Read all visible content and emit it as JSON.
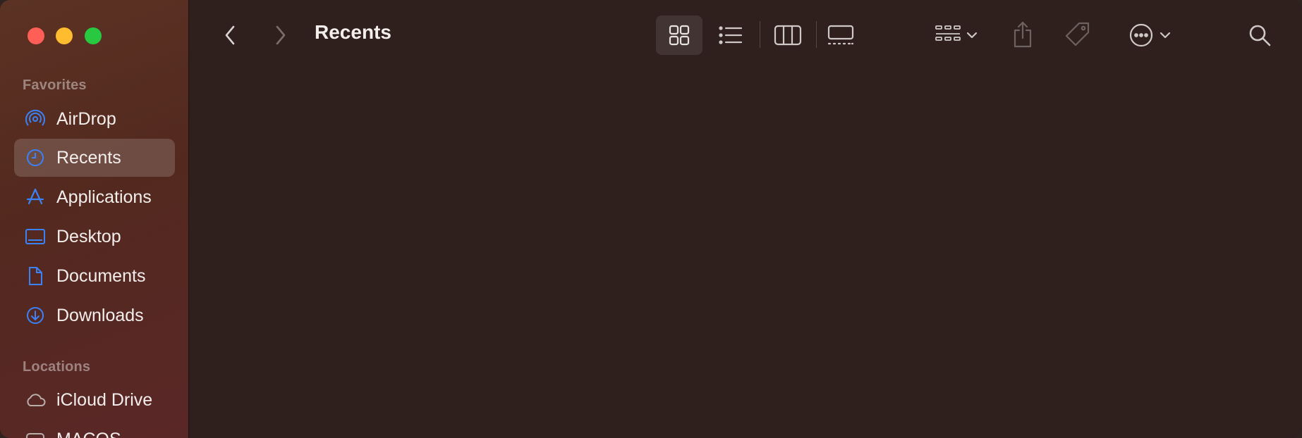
{
  "window": {
    "title": "Recents"
  },
  "sidebar": {
    "favorites_header": "Favorites",
    "locations_header": "Locations",
    "favorites": [
      {
        "label": "AirDrop",
        "icon": "airdrop-icon"
      },
      {
        "label": "Recents",
        "icon": "clock-icon",
        "selected": true
      },
      {
        "label": "Applications",
        "icon": "applications-icon"
      },
      {
        "label": "Desktop",
        "icon": "desktop-icon"
      },
      {
        "label": "Documents",
        "icon": "document-icon"
      },
      {
        "label": "Downloads",
        "icon": "download-icon"
      }
    ],
    "locations": [
      {
        "label": "iCloud Drive",
        "icon": "cloud-icon"
      },
      {
        "label": "MACOS",
        "icon": "disk-icon"
      }
    ]
  },
  "toolbar": {
    "back": "chevron-left-icon",
    "forward": "chevron-right-icon",
    "views": [
      "icon-view",
      "list-view",
      "column-view",
      "gallery-view"
    ],
    "selected_view": "icon-view",
    "group": "group-icon",
    "share": "share-icon",
    "tag": "tag-icon",
    "more": "ellipsis-icon",
    "search": "search-icon"
  },
  "colors": {
    "accent": "#3b82f6",
    "close": "#ff5f57",
    "minimize": "#febc2e",
    "zoom": "#28c840",
    "sidebar_bg": "#56301f",
    "main_bg": "#2f201e"
  }
}
